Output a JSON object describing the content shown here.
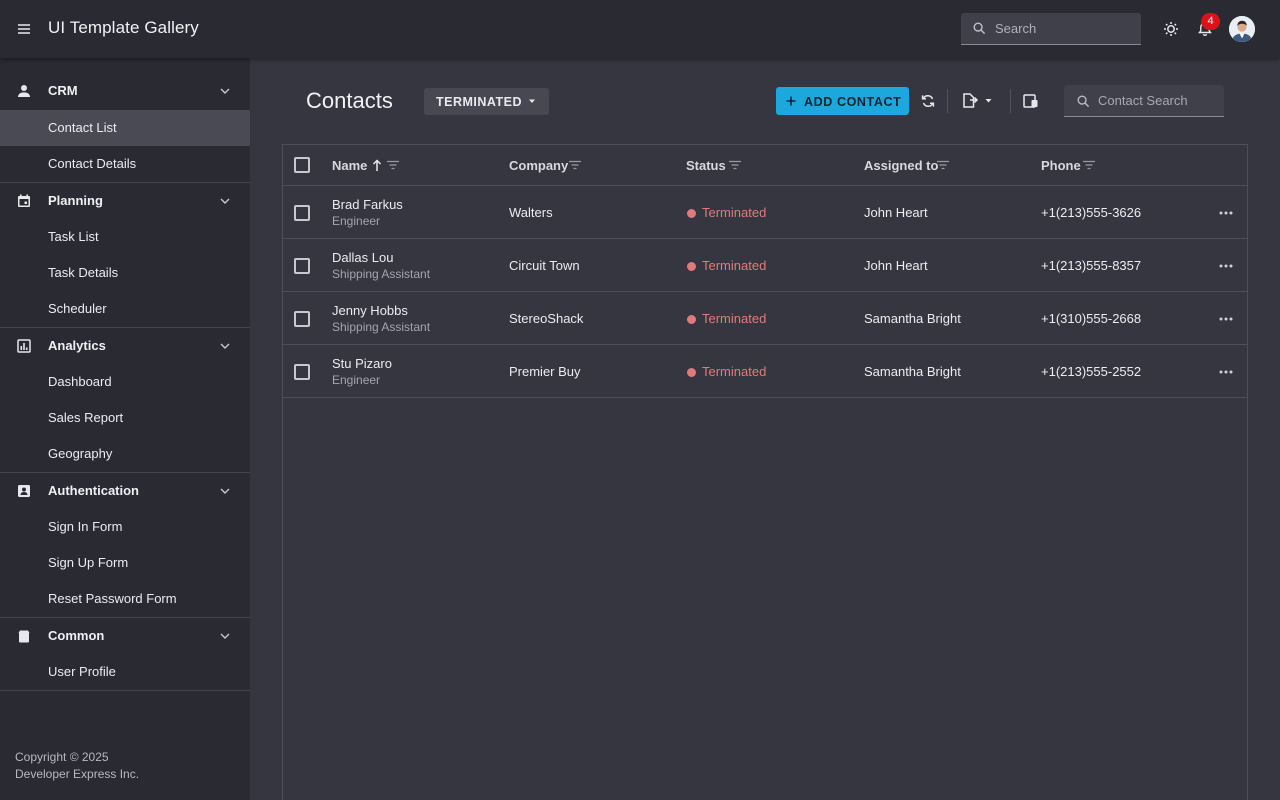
{
  "header": {
    "app_title": "UI Template Gallery",
    "search_placeholder": "Search",
    "notification_count": "4"
  },
  "sidebar": {
    "groups": [
      {
        "label": "CRM",
        "icon": "person-icon",
        "items": [
          "Contact List",
          "Contact Details"
        ]
      },
      {
        "label": "Planning",
        "icon": "calendar-icon",
        "items": [
          "Task List",
          "Task Details",
          "Scheduler"
        ]
      },
      {
        "label": "Analytics",
        "icon": "chart-icon",
        "items": [
          "Dashboard",
          "Sales Report",
          "Geography"
        ]
      },
      {
        "label": "Authentication",
        "icon": "contact-card-icon",
        "items": [
          "Sign In Form",
          "Sign Up Form",
          "Reset Password Form"
        ]
      },
      {
        "label": "Common",
        "icon": "box-icon",
        "items": [
          "User Profile"
        ]
      }
    ],
    "active_item": "Contact List",
    "copyright_line1": "Copyright © 2025",
    "copyright_line2": "Developer Express Inc."
  },
  "toolbar": {
    "page_title": "Contacts",
    "status_filter": "TERMINATED",
    "add_label": "ADD CONTACT",
    "search_placeholder": "Contact Search"
  },
  "grid": {
    "columns": [
      "Name",
      "Company",
      "Status",
      "Assigned to",
      "Phone"
    ],
    "sort_column": "Name",
    "sort_direction": "ascending",
    "status_color": "#e07b7b",
    "rows": [
      {
        "name": "Brad Farkus",
        "position": "Engineer",
        "company": "Walters",
        "status": "Terminated",
        "assigned": "John Heart",
        "phone": "+1(213)555-3626"
      },
      {
        "name": "Dallas Lou",
        "position": "Shipping Assistant",
        "company": "Circuit Town",
        "status": "Terminated",
        "assigned": "John Heart",
        "phone": "+1(213)555-8357"
      },
      {
        "name": "Jenny Hobbs",
        "position": "Shipping Assistant",
        "company": "StereoShack",
        "status": "Terminated",
        "assigned": "Samantha Bright",
        "phone": "+1(310)555-2668"
      },
      {
        "name": "Stu Pizaro",
        "position": "Engineer",
        "company": "Premier Buy",
        "status": "Terminated",
        "assigned": "Samantha Bright",
        "phone": "+1(213)555-2552"
      }
    ]
  },
  "colors": {
    "accent": "#1ca8dd",
    "badge": "#e0101a",
    "background": "#363640",
    "panel": "#2a2a33"
  }
}
